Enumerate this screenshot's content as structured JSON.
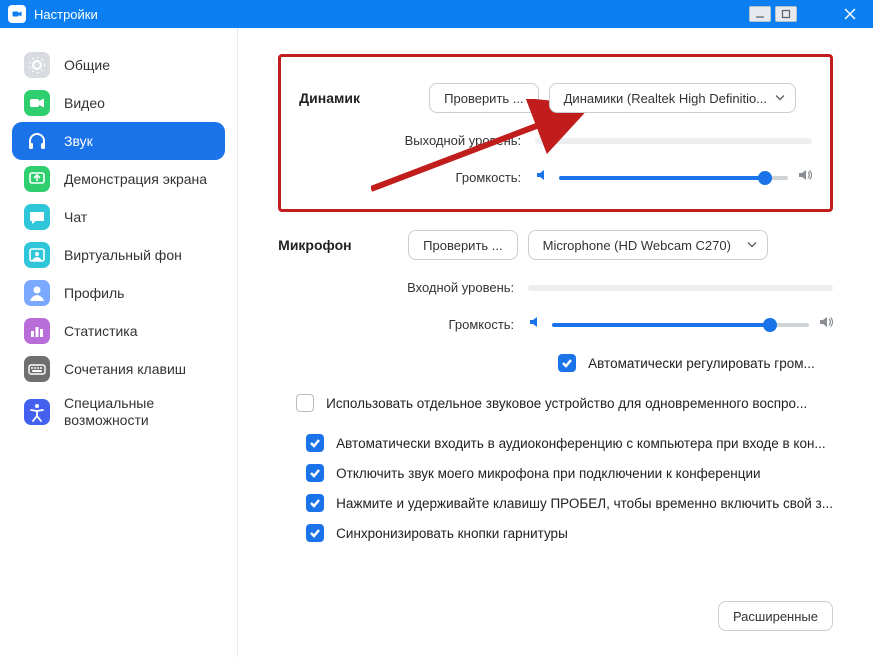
{
  "title": "Настройки",
  "sidebar": {
    "items": [
      {
        "label": "Общие",
        "icon": "gear",
        "color": "#d0d4d8"
      },
      {
        "label": "Видео",
        "icon": "video",
        "color": "#2fcf6f"
      },
      {
        "label": "Звук",
        "icon": "headphones",
        "color": "#1a73e8",
        "active": true
      },
      {
        "label": "Демонстрация экрана",
        "icon": "share",
        "color": "#2fcf6f"
      },
      {
        "label": "Чат",
        "icon": "chat",
        "color": "#2fc6d9"
      },
      {
        "label": "Виртуальный фон",
        "icon": "virtual-bg",
        "color": "#2fc6d9"
      },
      {
        "label": "Профиль",
        "icon": "profile",
        "color": "#7aa9ff"
      },
      {
        "label": "Статистика",
        "icon": "stats",
        "color": "#b86dd9"
      },
      {
        "label": "Сочетания клавиш",
        "icon": "keyboard",
        "color": "#6f6f6f"
      },
      {
        "label": "Специальные возможности",
        "icon": "accessibility",
        "color": "#4361ee"
      }
    ]
  },
  "speaker": {
    "section_label": "Динамик",
    "test_btn": "Проверить ...",
    "device": "Динамики (Realtek High Definitio...",
    "output_label": "Выходной уровень:",
    "volume_label": "Громкость:",
    "volume_pct": 90
  },
  "mic": {
    "section_label": "Микрофон",
    "test_btn": "Проверить ...",
    "device": "Microphone (HD Webcam C270)",
    "input_label": "Входной уровень:",
    "volume_label": "Громкость:",
    "volume_pct": 85,
    "auto_adjust": "Автоматически регулировать гром..."
  },
  "options": {
    "separate_device": "Использовать отдельное звуковое устройство для одновременного воспро...",
    "auto_join": "Автоматически входить в аудиоконференцию с компьютера при входе в кон...",
    "mute_on_join": "Отключить звук моего микрофона при подключении к конференции",
    "space_unmute": "Нажмите и удерживайте клавишу ПРОБЕЛ, чтобы временно включить свой з...",
    "sync_headset": "Синхронизировать кнопки гарнитуры"
  },
  "advanced_btn": "Расширенные"
}
